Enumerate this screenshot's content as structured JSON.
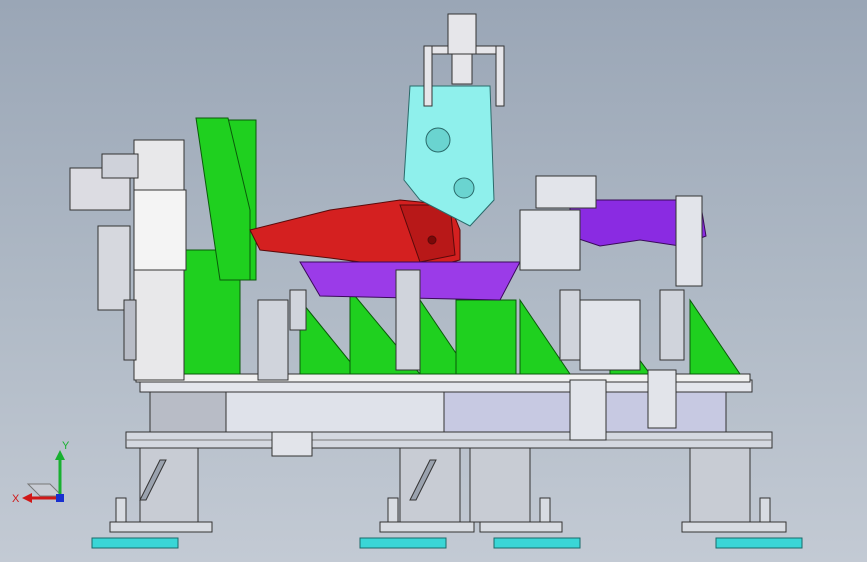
{
  "triad": {
    "x_label": "X",
    "y_label": "Y",
    "x_color": "#d01818",
    "y_color": "#18b030",
    "z_color": "#1830d0"
  },
  "colors": {
    "background_top": "#9aa6b6",
    "background_bottom": "#c3cad4",
    "fixture_green": "#1fd01f",
    "part_red": "#d42020",
    "part_purple": "#8a2be2",
    "part_cyan": "#8ff0ec",
    "steel_gray": "#c8ccd4",
    "pad_cyan": "#3ad6d6"
  }
}
